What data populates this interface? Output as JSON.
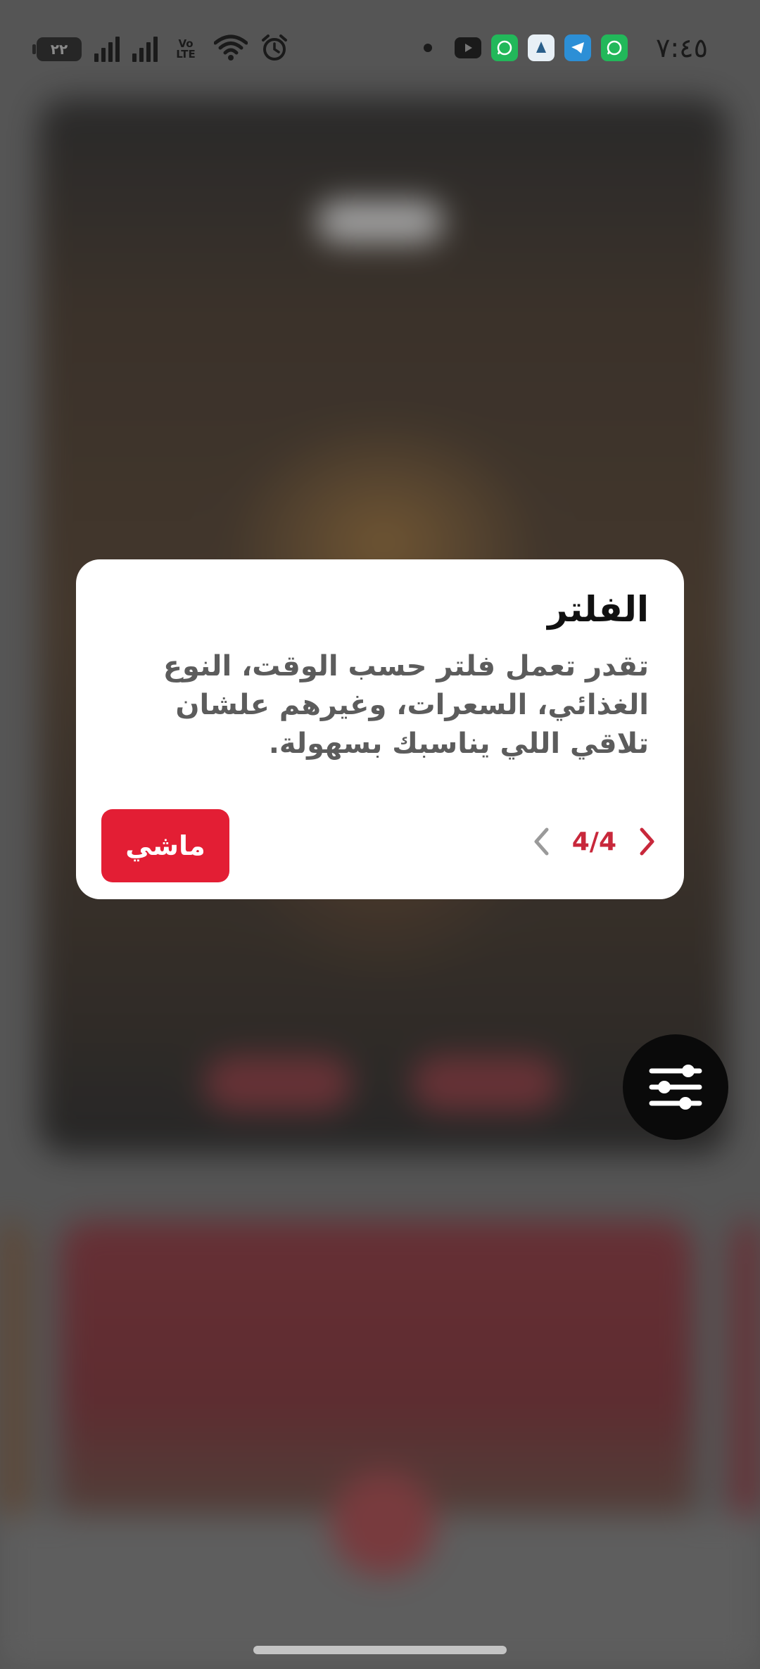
{
  "status_bar": {
    "time": "٧:٤٥",
    "battery_level": "٢٢",
    "network_badge": "Vo LTE",
    "notification_icons": [
      "dot-icon",
      "youtube-icon",
      "whatsapp-icon",
      "app-icon",
      "telegram-icon",
      "whatsapp-icon"
    ],
    "system_icons": [
      "battery-icon",
      "signal-icon",
      "signal-icon",
      "volte-icon",
      "wifi-icon",
      "alarm-icon"
    ]
  },
  "tour": {
    "title": "الفلتر",
    "description": "تقدر تعمل فلتر حسب الوقت، النوع الغذائي، السعرات، وغيرهم علشان تلاقي اللي يناسبك بسهولة.",
    "ok_label": "ماشي",
    "pager": "4/4"
  },
  "filter_button": {
    "icon": "sliders-icon"
  },
  "colors": {
    "accent": "#e31e34",
    "pager_accent": "#c8283b",
    "card_bg": "#ffffff",
    "title": "#111111",
    "description": "#5c5c5c"
  }
}
